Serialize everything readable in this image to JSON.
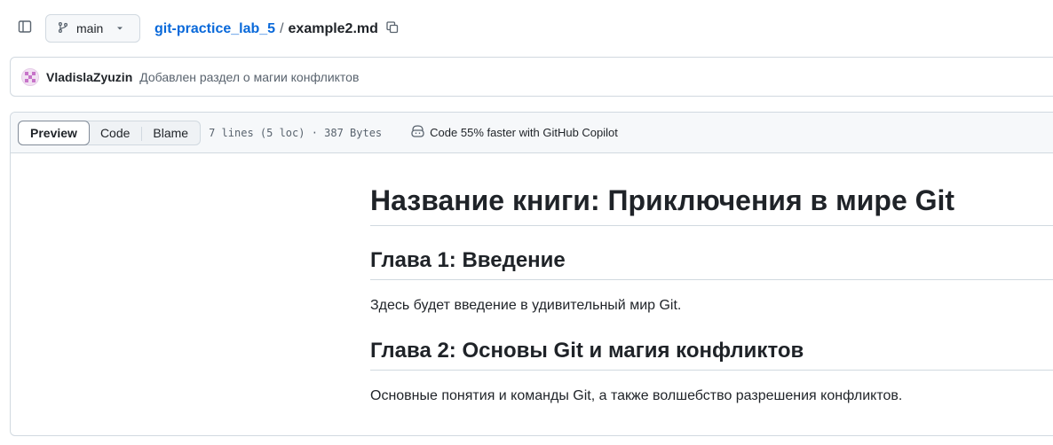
{
  "toolbar": {
    "branch_label": "main",
    "repo_link": "git-practice_lab_5",
    "separator": "/",
    "file_name": "example2.md"
  },
  "commit": {
    "author": "VladislaZyuzin",
    "message": "Добавлен раздел о магии конфликтов"
  },
  "file_header": {
    "tabs": [
      "Preview",
      "Code",
      "Blame"
    ],
    "active_tab": "Preview",
    "info": "7 lines (5 loc) · 387 Bytes",
    "copilot_text": "Code 55% faster with GitHub Copilot"
  },
  "content": {
    "title": "Название книги: Приключения в мире Git",
    "chapter1_heading": "Глава 1: Введение",
    "chapter1_text": "Здесь будет введение в удивительный мир Git.",
    "chapter2_heading": "Глава 2: Основы Git и магия конфликтов",
    "chapter2_text": "Основные понятия и команды Git, а также волшебство разрешения конфликтов."
  },
  "icons": {
    "sidepanel": "sidepanel-icon",
    "branch": "git-branch-icon",
    "caret": "triangle-down-icon",
    "copy": "copy-icon",
    "copilot": "copilot-icon"
  },
  "colors": {
    "link": "#0969da",
    "text": "#1f2328",
    "muted": "#59636e",
    "border": "#d1d9e0",
    "header_bg": "#f6f8fa"
  }
}
